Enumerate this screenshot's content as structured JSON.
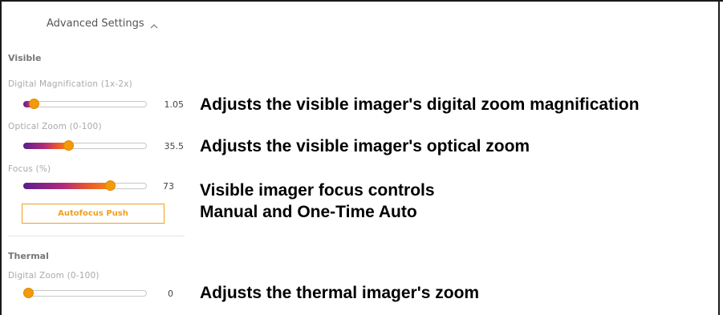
{
  "advanced_settings": {
    "label": "Advanced Settings",
    "icon": "chevron-up-icon",
    "expanded": true
  },
  "visible": {
    "section_label": "Visible",
    "digital_magnification": {
      "label": "Digital Magnification (1x-2x)",
      "value": "1.05",
      "level": 0.05
    },
    "optical_zoom": {
      "label": "Optical Zoom (0-100)",
      "value": "35.5",
      "level": 0.355
    },
    "focus": {
      "label": "Focus (%)",
      "value": "73",
      "level": 0.73
    },
    "autofocus_button": "Autofocus Push"
  },
  "thermal": {
    "section_label": "Thermal",
    "digital_zoom": {
      "label": "Digital Zoom (0-100)",
      "value": "0",
      "level": 0.0
    }
  },
  "annotations": {
    "digital_magnification": "Adjusts the visible imager's digital zoom magnification",
    "optical_zoom": "Adjusts the visible imager's optical zoom",
    "focus_line1": "Visible imager focus controls",
    "focus_line2": "Manual and One-Time Auto",
    "thermal_zoom": "Adjusts the thermal imager's zoom"
  },
  "colors": {
    "accent": "#f29a0a",
    "gradient": [
      "#5a1e8e",
      "#b12b7a",
      "#ec5a2b",
      "#f48a1a"
    ]
  }
}
